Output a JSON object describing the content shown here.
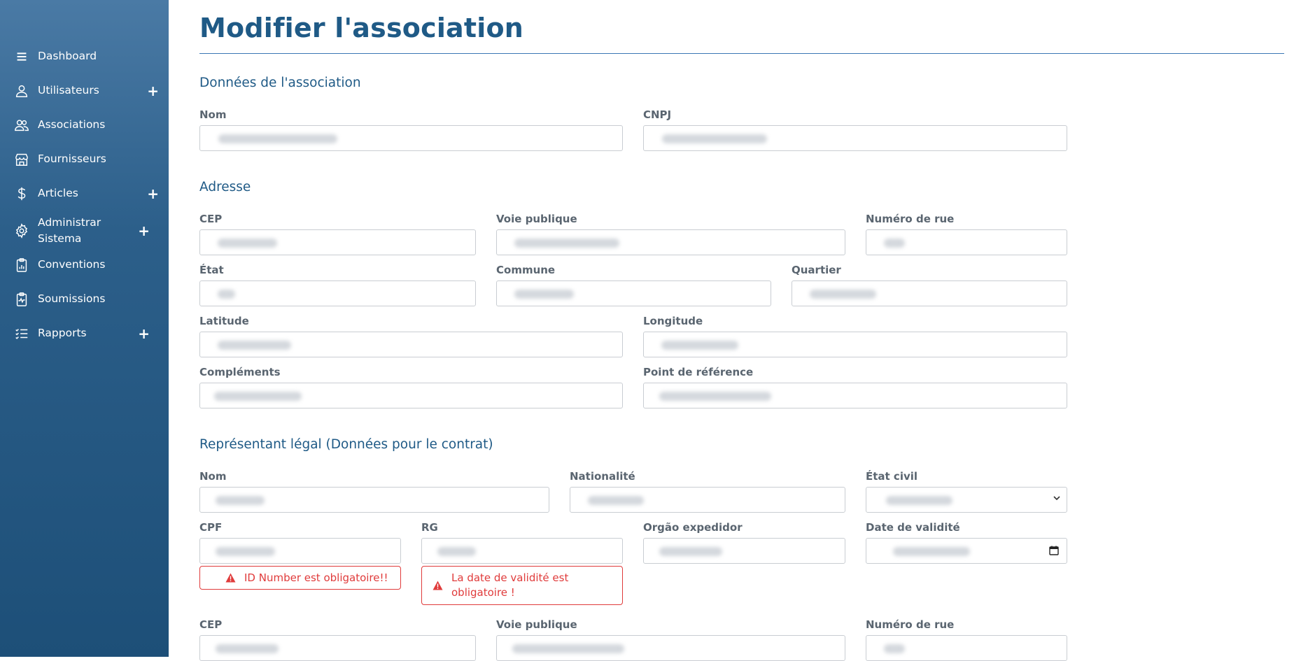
{
  "sidebar": {
    "items": [
      {
        "label": "Dashboard",
        "icon": "menu-icon",
        "expand": false
      },
      {
        "label": "Utilisateurs",
        "icon": "user-icon",
        "expand": true,
        "expand_symbol": "+"
      },
      {
        "label": "Associations",
        "icon": "users-icon",
        "expand": false
      },
      {
        "label": "Fournisseurs",
        "icon": "store-icon",
        "expand": false
      },
      {
        "label": "Articles",
        "icon": "dollar-icon",
        "expand": true,
        "expand_symbol": "+"
      },
      {
        "label": "Administrar Sistema",
        "icon": "gear-icon",
        "expand": true,
        "expand_symbol": "+"
      },
      {
        "label": "Conventions",
        "icon": "clipboard-chart-icon",
        "expand": false
      },
      {
        "label": "Soumissions",
        "icon": "clipboard-pulse-icon",
        "expand": false
      },
      {
        "label": "Rapports",
        "icon": "checklist-icon",
        "expand": true,
        "expand_symbol": "+"
      }
    ]
  },
  "page": {
    "title": "Modifier l'association"
  },
  "sections": {
    "association": {
      "title": "Données de l'association",
      "nom": {
        "label": "Nom",
        "value": ""
      },
      "cnpj": {
        "label": "CNPJ",
        "value": ""
      }
    },
    "adresse": {
      "title": "Adresse",
      "cep": {
        "label": "CEP",
        "value": ""
      },
      "voie": {
        "label": "Voie publique",
        "value": ""
      },
      "numero": {
        "label": "Numéro de rue",
        "value": ""
      },
      "etat": {
        "label": "État",
        "value": ""
      },
      "commune": {
        "label": "Commune",
        "value": ""
      },
      "quartier": {
        "label": "Quartier",
        "value": ""
      },
      "latitude": {
        "label": "Latitude",
        "value": ""
      },
      "longitude": {
        "label": "Longitude",
        "value": ""
      },
      "complements": {
        "label": "Compléments",
        "value": ""
      },
      "reference": {
        "label": "Point de référence",
        "value": ""
      }
    },
    "representant": {
      "title": "Représentant légal (Données pour le contrat)",
      "nom": {
        "label": "Nom",
        "value": ""
      },
      "nationalite": {
        "label": "Nationalité",
        "value": ""
      },
      "etat_civil": {
        "label": "État civil",
        "value": ""
      },
      "cpf": {
        "label": "CPF",
        "value": ""
      },
      "rg": {
        "label": "RG",
        "value": ""
      },
      "orgao": {
        "label": "Orgão expedidor",
        "value": ""
      },
      "validite": {
        "label": "Date de validité",
        "value": ""
      },
      "cep": {
        "label": "CEP",
        "value": ""
      },
      "voie": {
        "label": "Voie publique",
        "value": ""
      },
      "numero": {
        "label": "Numéro de rue",
        "value": ""
      }
    }
  },
  "errors": {
    "cpf": "ID Number est obligatoire!!",
    "rg": "La date de validité est obligatoire !"
  },
  "colors": {
    "accent": "#1f5a86",
    "error": "#e03b3b",
    "sidebar_top": "#4a7aa5",
    "sidebar_bottom": "#1d4f78"
  }
}
